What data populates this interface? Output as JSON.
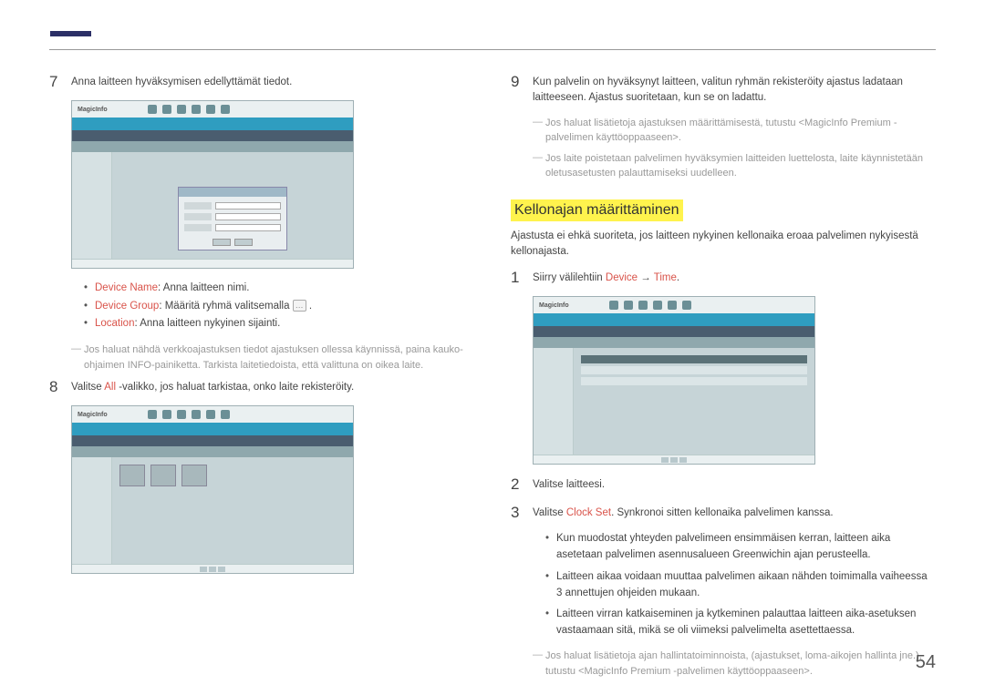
{
  "pageNumber": "54",
  "left": {
    "step7": {
      "num": "7",
      "text": "Anna laitteen hyväksymisen edellyttämät tiedot."
    },
    "screenshot1_logo": "MagicInfo",
    "bullets": {
      "b1_kw": "Device Name",
      "b1_rest": ": Anna laitteen nimi.",
      "b2_kw": "Device Group",
      "b2_rest": ": Määritä ryhmä valitsemalla ",
      "b2_btn": "…",
      "b2_tail": " .",
      "b3_kw": "Location",
      "b3_rest": ": Anna laitteen nykyinen sijainti."
    },
    "note1": "Jos haluat nähdä verkkoajastuksen tiedot ajastuksen ollessa käynnissä, paina kauko-ohjaimen INFO-painiketta. Tarkista laitetiedoista, että valittuna on oikea laite.",
    "step8": {
      "num": "8",
      "pre": "Valitse ",
      "kw": "All",
      "post": " -valikko, jos haluat tarkistaa, onko laite rekisteröity."
    },
    "screenshot2_logo": "MagicInfo"
  },
  "right": {
    "step9": {
      "num": "9",
      "text": "Kun palvelin on hyväksynyt laitteen, valitun ryhmän rekisteröity ajastus ladataan laitteeseen. Ajastus suoritetaan, kun se on ladattu."
    },
    "note_r1": "Jos haluat lisätietoja ajastuksen määrittämisestä, tutustu <MagicInfo Premium -palvelimen käyttöoppaaseen>.",
    "note_r2": "Jos laite poistetaan palvelimen hyväksymien laitteiden luettelosta, laite käynnistetään oletusasetusten palauttamiseksi uudelleen.",
    "heading": "Kellonajan määrittäminen",
    "intro": "Ajastusta ei ehkä suoriteta, jos laitteen nykyinen kellonaika eroaa palvelimen nykyisestä kellonajasta.",
    "step1": {
      "num": "1",
      "pre": "Siirry välilehtiin ",
      "kw1": "Device",
      "arrow": " → ",
      "kw2": "Time",
      "post": "."
    },
    "screenshot3_logo": "MagicInfo",
    "step2": {
      "num": "2",
      "text": "Valitse laitteesi."
    },
    "step3": {
      "num": "3",
      "pre": "Valitse ",
      "kw": "Clock Set",
      "post": ". Synkronoi sitten kellonaika palvelimen kanssa."
    },
    "sub": {
      "s1": "Kun muodostat yhteyden palvelimeen ensimmäisen kerran, laitteen aika asetetaan palvelimen asennusalueen Greenwichin ajan perusteella.",
      "s2": "Laitteen aikaa voidaan muuttaa palvelimen aikaan nähden toimimalla vaiheessa 3 annettujen ohjeiden mukaan.",
      "s3": "Laitteen virran katkaiseminen ja kytkeminen palauttaa laitteen aika-asetuksen vastaamaan sitä, mikä se oli viimeksi palvelimelta asettettaessa."
    },
    "note_r3": "Jos haluat lisätietoja ajan hallintatoiminnoista, (ajastukset, loma-aikojen hallinta jne.), tutustu <MagicInfo Premium -palvelimen käyttöoppaaseen>."
  }
}
